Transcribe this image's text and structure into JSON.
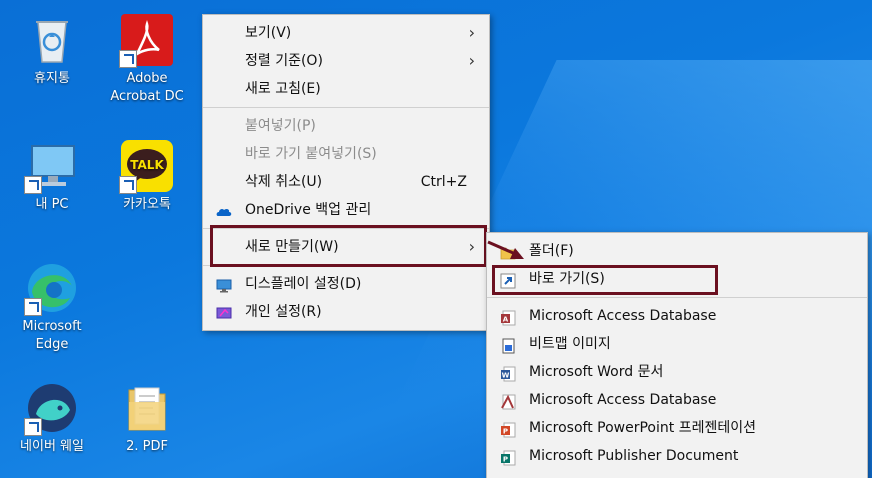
{
  "desktop_icons": [
    {
      "id": "recycle-bin",
      "label": "휴지통",
      "shortcut": false
    },
    {
      "id": "adobe-acrobat",
      "label": "Adobe\nAcrobat DC",
      "shortcut": true
    },
    {
      "id": "my-pc",
      "label": "내 PC",
      "shortcut": true
    },
    {
      "id": "kakaotalk",
      "label": "카카오톡",
      "shortcut": true,
      "icon_text": "TALK"
    },
    {
      "id": "edge",
      "label": "Microsoft\nEdge",
      "shortcut": true
    },
    {
      "id": "naver-whale",
      "label": "네이버 웨일",
      "shortcut": true
    },
    {
      "id": "pdf-folder",
      "label": "2. PDF",
      "shortcut": false
    }
  ],
  "context_menu": {
    "items": [
      {
        "label": "보기(V)",
        "submenu": true,
        "disabled": false
      },
      {
        "label": "정렬 기준(O)",
        "submenu": true,
        "disabled": false
      },
      {
        "label": "새로 고침(E)",
        "submenu": false,
        "disabled": false
      },
      {
        "label": "붙여넣기(P)",
        "disabled": true
      },
      {
        "label": "바로 가기 붙여넣기(S)",
        "disabled": true
      },
      {
        "label": "삭제 취소(U)",
        "accelerator": "Ctrl+Z",
        "disabled": false
      },
      {
        "label": "OneDrive 백업 관리",
        "icon": "onedrive-icon",
        "disabled": false
      },
      {
        "label": "새로 만들기(W)",
        "submenu": true,
        "highlighted": true
      },
      {
        "label": "디스플레이 설정(D)",
        "icon": "display-icon"
      },
      {
        "label": "개인 설정(R)",
        "icon": "personalize-icon"
      }
    ]
  },
  "submenu_new": {
    "items": [
      {
        "label": "폴더(F)",
        "icon": "folder-icon"
      },
      {
        "label": "바로 가기(S)",
        "icon": "shortcut-icon",
        "highlighted": true
      },
      {
        "label": "Microsoft Access Database",
        "icon": "access-icon"
      },
      {
        "label": "비트맵 이미지",
        "icon": "bitmap-icon"
      },
      {
        "label": "Microsoft Word 문서",
        "icon": "word-icon"
      },
      {
        "label": "Microsoft Access Database",
        "icon": "access-icon"
      },
      {
        "label": "Microsoft PowerPoint 프레젠테이션",
        "icon": "powerpoint-icon"
      },
      {
        "label": "Microsoft Publisher Document",
        "icon": "publisher-icon"
      }
    ]
  },
  "colors": {
    "highlight_border": "#6b1020",
    "desktop_blue": "#0b78dd"
  }
}
